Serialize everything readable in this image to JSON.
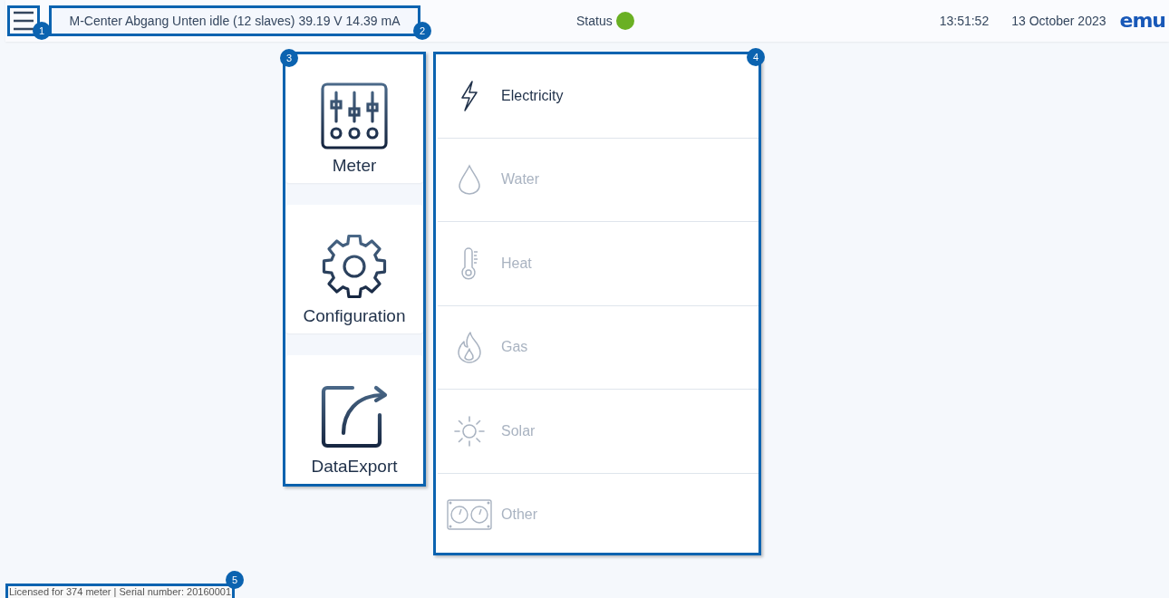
{
  "header": {
    "menu_button": {
      "callout": "1"
    },
    "device": {
      "text": "M-Center Abgang Unten idle (12 slaves) 39.19 V 14.39 mA",
      "callout": "2"
    },
    "status": {
      "label": "Status",
      "on": true
    },
    "time": "13:51:52",
    "date": "13 October 2023",
    "logo": "emu"
  },
  "nav": {
    "callout": "3",
    "items": [
      {
        "label": "Meter",
        "kind": "meter"
      },
      {
        "label": "Configuration",
        "kind": "configuration"
      },
      {
        "label": "DataExport",
        "kind": "export"
      }
    ]
  },
  "categories": {
    "callout": "4",
    "items": [
      {
        "label": "Electricity",
        "kind": "electricity",
        "disabled": false
      },
      {
        "label": "Water",
        "kind": "water",
        "disabled": true
      },
      {
        "label": "Heat",
        "kind": "heat",
        "disabled": true
      },
      {
        "label": "Gas",
        "kind": "gas",
        "disabled": true
      },
      {
        "label": "Solar",
        "kind": "solar",
        "disabled": true
      },
      {
        "label": "Other",
        "kind": "other",
        "disabled": true
      }
    ]
  },
  "footer": {
    "text": "Licensed for 374 meter | Serial number: 20160001",
    "callout": "5"
  }
}
